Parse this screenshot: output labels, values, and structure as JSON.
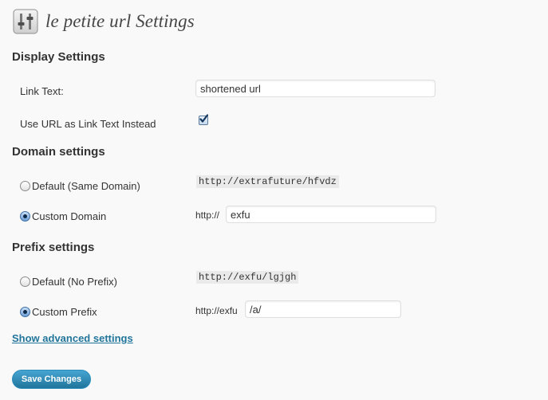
{
  "page": {
    "title": "le petite url Settings",
    "icon": "settings-sliders-icon"
  },
  "display_settings": {
    "heading": "Display Settings",
    "link_text_label": "Link Text:",
    "link_text_value": "shortened url",
    "use_url_label": "Use URL as Link Text Instead",
    "use_url_checked": true
  },
  "domain_settings": {
    "heading": "Domain settings",
    "default_label": "Default (Same Domain)",
    "default_example": "http://extrafuture/hfvdz",
    "custom_label": "Custom Domain",
    "custom_prefix": "http://",
    "custom_value": "exfu",
    "selected": "custom"
  },
  "prefix_settings": {
    "heading": "Prefix settings",
    "default_label": "Default (No Prefix)",
    "default_example": "http://exfu/lgjgh",
    "custom_label": "Custom Prefix",
    "custom_prefix": "http://exfu",
    "custom_value": "/a/",
    "selected": "custom"
  },
  "advanced_link": "Show advanced settings",
  "save_button": "Save Changes",
  "colors": {
    "accent": "#21759b",
    "background": "#f9f9f9"
  }
}
